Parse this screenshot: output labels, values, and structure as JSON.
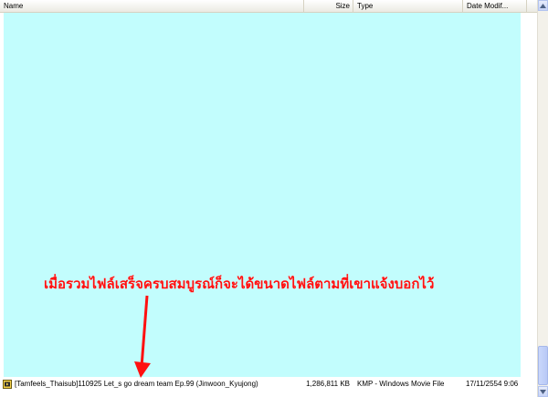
{
  "columns": {
    "name": "Name",
    "size": "Size",
    "type": "Type",
    "date": "Date Modif..."
  },
  "overlay": {
    "caption": "เมื่อรวมไฟล์เสร็จครบสมบูรณ์ก็จะได้ขนาดไฟล์ตามที่เขาแจ้งบอกไว้",
    "caption_color": "#ff1010",
    "background": "#c2fdfd"
  },
  "file": {
    "name": "[Tamfeels_Thaisub]110925 Let_s go dream team Ep.99 (Jinwoon_Kyujong)",
    "size": "1,286,811 KB",
    "type": "KMP - Windows Movie File",
    "date": "17/11/2554 9:06",
    "icon": "movie-file-icon"
  },
  "scrollbar": {
    "up_icon": "scroll-up-arrow-icon",
    "down_icon": "scroll-down-arrow-icon"
  }
}
